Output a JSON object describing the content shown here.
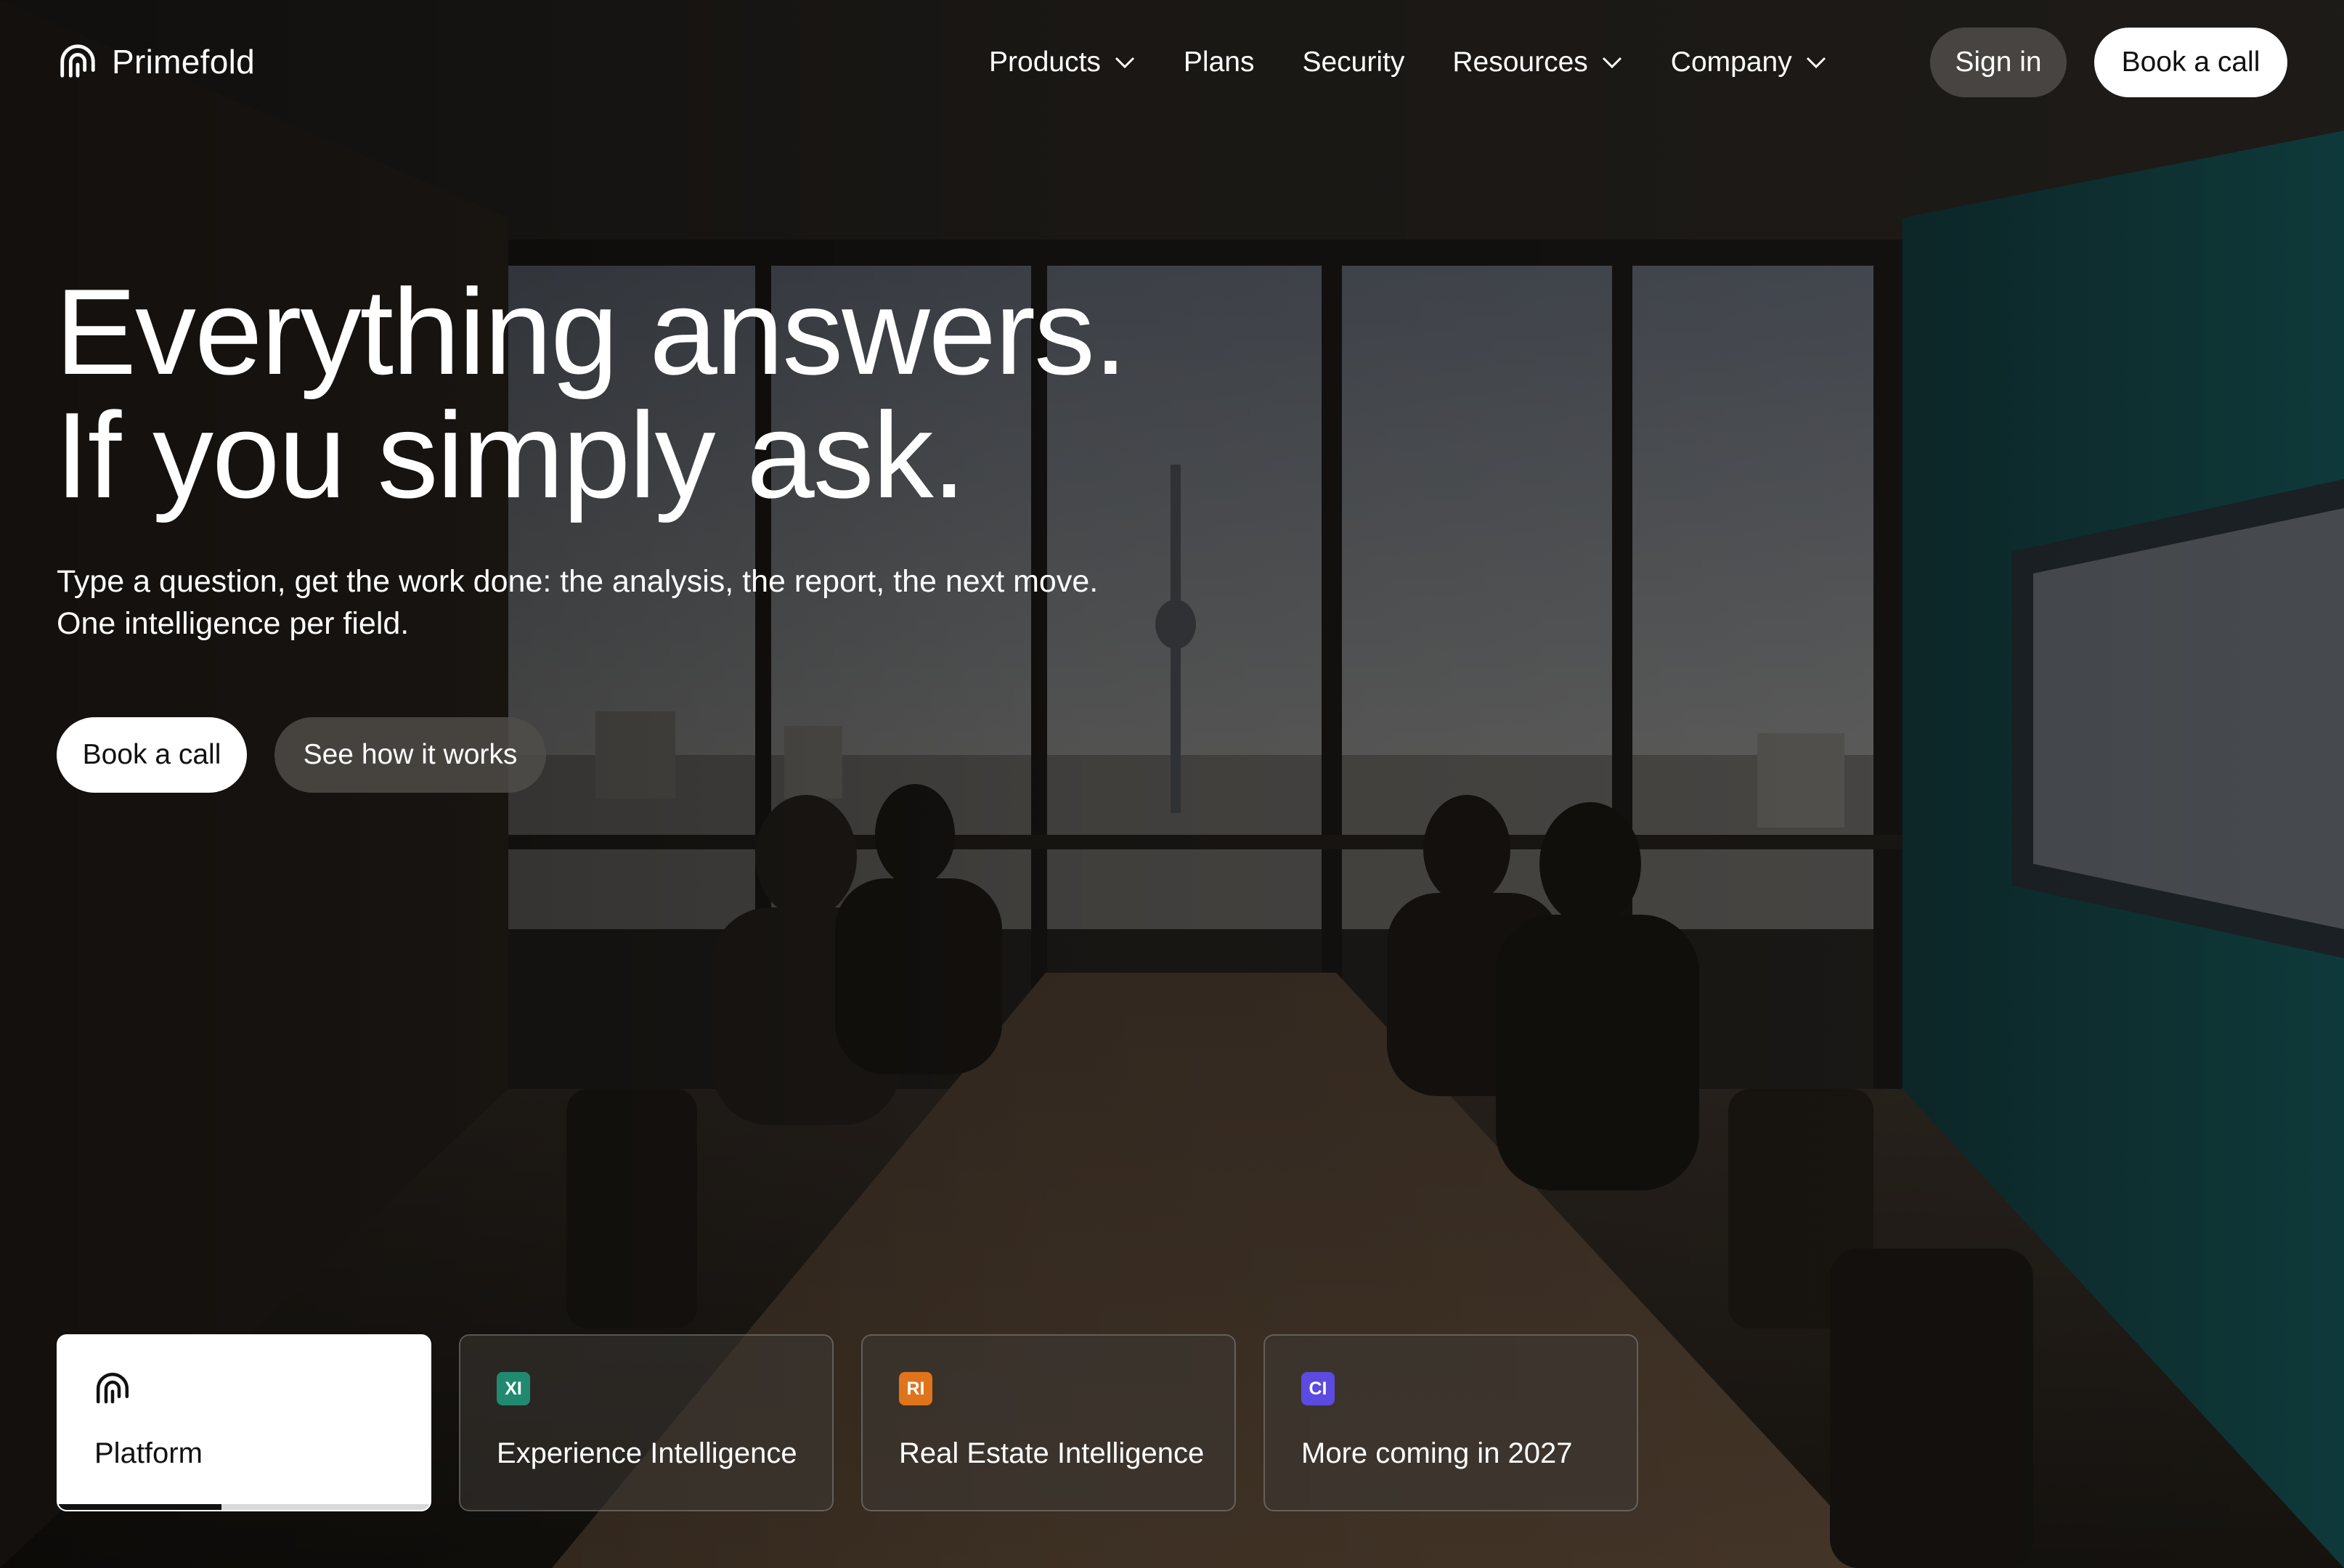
{
  "brand": {
    "name": "Primefold"
  },
  "nav": {
    "items": [
      {
        "label": "Products",
        "has_dropdown": true
      },
      {
        "label": "Plans",
        "has_dropdown": false
      },
      {
        "label": "Security",
        "has_dropdown": false
      },
      {
        "label": "Resources",
        "has_dropdown": true
      },
      {
        "label": "Company",
        "has_dropdown": true
      }
    ],
    "sign_in_label": "Sign in",
    "book_call_label": "Book a call"
  },
  "hero": {
    "headline_line1": "Everything answers.",
    "headline_line2": "If you simply ask.",
    "sub_line1": "Type a question, get the work done: the analysis, the report, the next move.",
    "sub_line2": "One intelligence per field.",
    "primary_cta": "Book a call",
    "secondary_cta": "See how it works"
  },
  "cards": [
    {
      "label": "Platform",
      "icon": "primefold-logo-icon",
      "active": true,
      "progress": 0.44
    },
    {
      "label": "Experience Intelligence",
      "badge": "XI",
      "badge_color": "#1f8a70",
      "active": false
    },
    {
      "label": "Real Estate Intelligence",
      "badge": "RI",
      "badge_color": "#e0741b",
      "active": false
    },
    {
      "label": "More coming in 2027",
      "badge": "CI",
      "badge_color": "#5b4be0",
      "active": false
    }
  ]
}
